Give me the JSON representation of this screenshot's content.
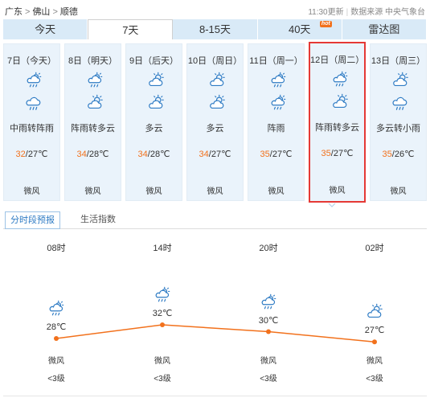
{
  "breadcrumb": {
    "province": "广东",
    "city": "佛山",
    "district": "顺德",
    "sep": ">"
  },
  "update": {
    "time": "11:30更新",
    "divider": "|",
    "source": "数据来源 中央气象台"
  },
  "tabs": [
    {
      "label": "今天"
    },
    {
      "label": "7天",
      "active": true
    },
    {
      "label": "8-15天"
    },
    {
      "label": "40天",
      "badge": "hot"
    },
    {
      "label": "雷达图"
    }
  ],
  "days": [
    {
      "date": "7日（今天）",
      "icon1": "thunder-shower-icon",
      "icon2": "rain-icon",
      "desc": "中雨转阵雨",
      "hi": "32",
      "lo": "/27℃",
      "wind": "微风"
    },
    {
      "date": "8日（明天）",
      "icon1": "thunder-shower-icon",
      "icon2": "partly-cloudy-icon",
      "desc": "阵雨转多云",
      "hi": "34",
      "lo": "/28℃",
      "wind": "微风"
    },
    {
      "date": "9日（后天）",
      "icon1": "partly-cloudy-icon",
      "icon2": "partly-cloudy-icon",
      "desc": "多云",
      "hi": "34",
      "lo": "/28℃",
      "wind": "微风"
    },
    {
      "date": "10日（周日）",
      "icon1": "partly-cloudy-icon",
      "icon2": "partly-cloudy-icon",
      "desc": "多云",
      "hi": "34",
      "lo": "/27℃",
      "wind": "微风"
    },
    {
      "date": "11日（周一）",
      "icon1": "thunder-shower-icon",
      "icon2": "thunder-shower-icon",
      "desc": "阵雨",
      "hi": "35",
      "lo": "/27℃",
      "wind": "微风"
    },
    {
      "date": "12日（周二）",
      "icon1": "thunder-shower-icon",
      "icon2": "partly-cloudy-icon",
      "desc": "阵雨转多云",
      "hi": "35",
      "lo": "/27℃",
      "wind": "微风",
      "selected": true
    },
    {
      "date": "13日（周三）",
      "icon1": "partly-cloudy-icon",
      "icon2": "rain-icon",
      "desc": "多云转小雨",
      "hi": "35",
      "lo": "/26℃",
      "wind": "微风"
    }
  ],
  "subtabs": {
    "active": "分时段预报",
    "other": "生活指数"
  },
  "hourly": [
    {
      "time": "08时",
      "icon": "thunder-shower-icon",
      "temp": "28℃",
      "value": 28,
      "wind": "微风",
      "level": "<3级"
    },
    {
      "time": "14时",
      "icon": "thunder-shower-icon",
      "temp": "32℃",
      "value": 32,
      "wind": "微风",
      "level": "<3级"
    },
    {
      "time": "20时",
      "icon": "thunder-shower-icon",
      "temp": "30℃",
      "value": 30,
      "wind": "微风",
      "level": "<3级"
    },
    {
      "time": "02时",
      "icon": "partly-cloudy-icon",
      "temp": "27℃",
      "value": 27,
      "wind": "微风",
      "level": "<3级"
    }
  ],
  "colors": {
    "accent": "#f2711c",
    "tab_bg": "#d9eaf7",
    "day_bg": "#eaf3fb",
    "icon": "#2e7bc4",
    "selected_border": "#e53935"
  }
}
